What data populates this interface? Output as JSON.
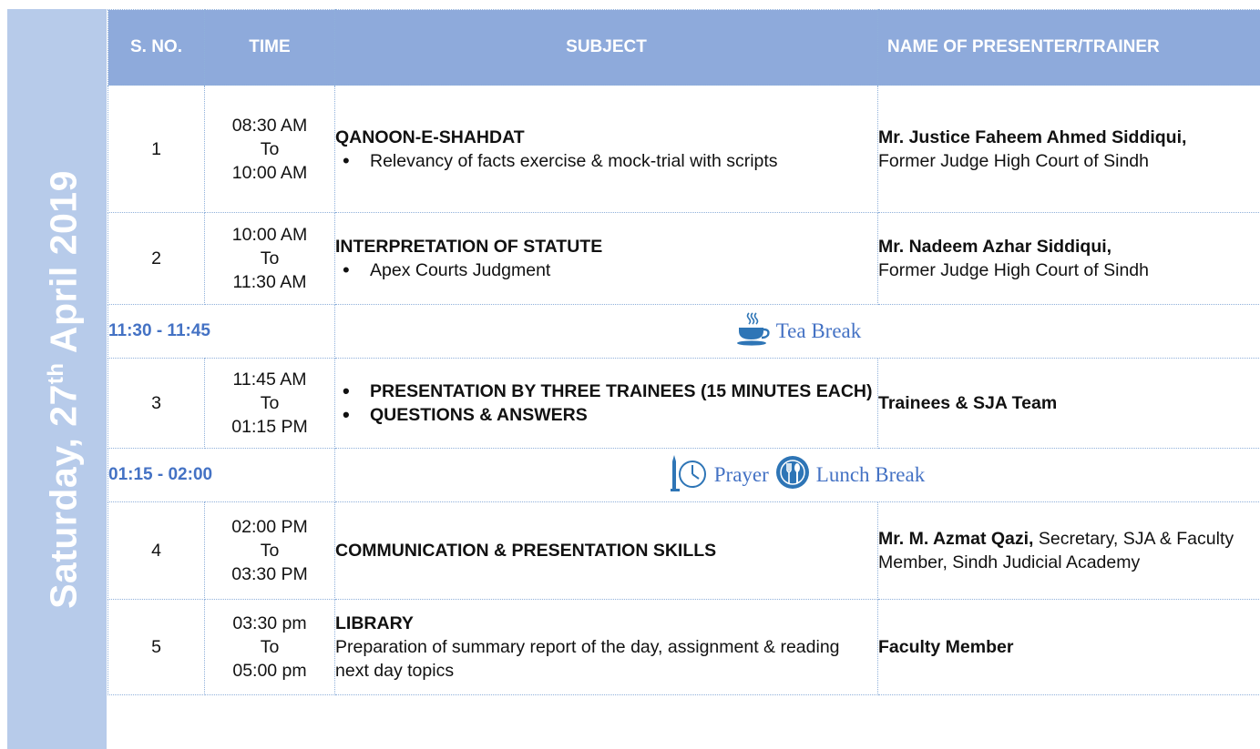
{
  "day_label": {
    "text": "Saturday, 27",
    "suffix": "th",
    "rest": " April 2019"
  },
  "headers": {
    "sno": "S. NO.",
    "time": "TIME",
    "subject": "SUBJECT",
    "presenter": "NAME OF PRESENTER/TRAINER"
  },
  "rows": [
    {
      "sno": "1",
      "time": [
        "08:30 AM",
        "To",
        "10:00 AM"
      ],
      "subject_title": "QANOON-E-SHAHDAT",
      "subject_bullets": [
        "Relevancy of facts exercise & mock-trial with scripts"
      ],
      "presenter_name": "Mr. Justice Faheem Ahmed Siddiqui,",
      "presenter_desc": "Former Judge High Court of Sindh"
    },
    {
      "sno": "2",
      "time": [
        "10:00 AM",
        "To",
        "11:30 AM"
      ],
      "subject_title": "INTERPRETATION OF STATUTE",
      "subject_bullets": [
        "Apex Courts Judgment"
      ],
      "presenter_name": "Mr. Nadeem Azhar Siddiqui,",
      "presenter_desc": "Former Judge High Court of Sindh"
    },
    {
      "sno": "3",
      "time": [
        "11:45 AM",
        "To",
        "01:15 PM"
      ],
      "subject_bullets": [
        "PRESENTATION BY THREE TRAINEES (15 MINUTES EACH)",
        "QUESTIONS & ANSWERS"
      ],
      "presenter_name": "Trainees & SJA Team"
    },
    {
      "sno": "4",
      "time": [
        "02:00 PM",
        "To",
        "03:30 PM"
      ],
      "subject_title": "COMMUNICATION & PRESENTATION SKILLS",
      "presenter_name": "Mr. M. Azmat Qazi,",
      "presenter_desc": " Secretary, SJA & Faculty Member, Sindh Judicial Academy"
    },
    {
      "sno": "5",
      "time": [
        "03:30 pm",
        "To",
        "05:00 pm"
      ],
      "subject_title": "LIBRARY",
      "subject_text": "Preparation of summary report of the day, assignment & reading next day topics",
      "presenter_name": "Faculty Member"
    }
  ],
  "breaks": [
    {
      "time": "11:30 - 11:45",
      "labels": [
        "Tea Break"
      ],
      "icons": [
        "tea-cup-icon"
      ]
    },
    {
      "time": "01:15 - 02:00",
      "labels": [
        "Prayer",
        "Lunch Break"
      ],
      "icons": [
        "clock-icon",
        "fork-spoon-icon"
      ]
    }
  ],
  "colors": {
    "header_bg": "#8eaadb",
    "day_band_bg": "#b7cbea",
    "accent_blue": "#4472c4",
    "border": "#8fb0da"
  }
}
